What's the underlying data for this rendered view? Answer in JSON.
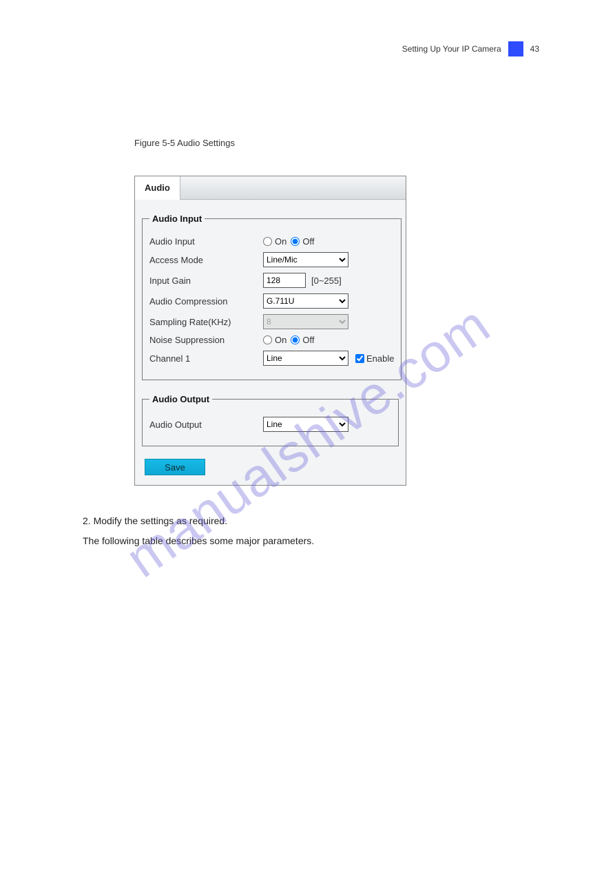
{
  "header": {
    "text": "Setting Up Your IP Camera",
    "page_no": "43"
  },
  "figure": {
    "caption": "Figure 5-5 Audio Settings",
    "tab": "Audio",
    "group_input": "Audio Input",
    "group_output": "Audio Output",
    "rows": {
      "audio_input_lbl": "Audio Input",
      "on": "On",
      "off": "Off",
      "access_mode_lbl": "Access Mode",
      "access_mode_val": "Line/Mic",
      "input_gain_lbl": "Input Gain",
      "input_gain_val": "128",
      "input_gain_range": "[0~255]",
      "compression_lbl": "Audio Compression",
      "compression_val": "G.711U",
      "sampling_lbl": "Sampling Rate(KHz)",
      "sampling_val": "8",
      "noise_lbl": "Noise Suppression",
      "channel1_lbl": "Channel 1",
      "channel1_val": "Line",
      "enable_lbl": "Enable",
      "audio_output_lbl": "Audio Output",
      "audio_output_val": "Line"
    },
    "save": "Save"
  },
  "body": {
    "line1": "2. Modify the settings as required.",
    "line2": "The following table describes some major parameters."
  },
  "watermark": "manualshive.com"
}
